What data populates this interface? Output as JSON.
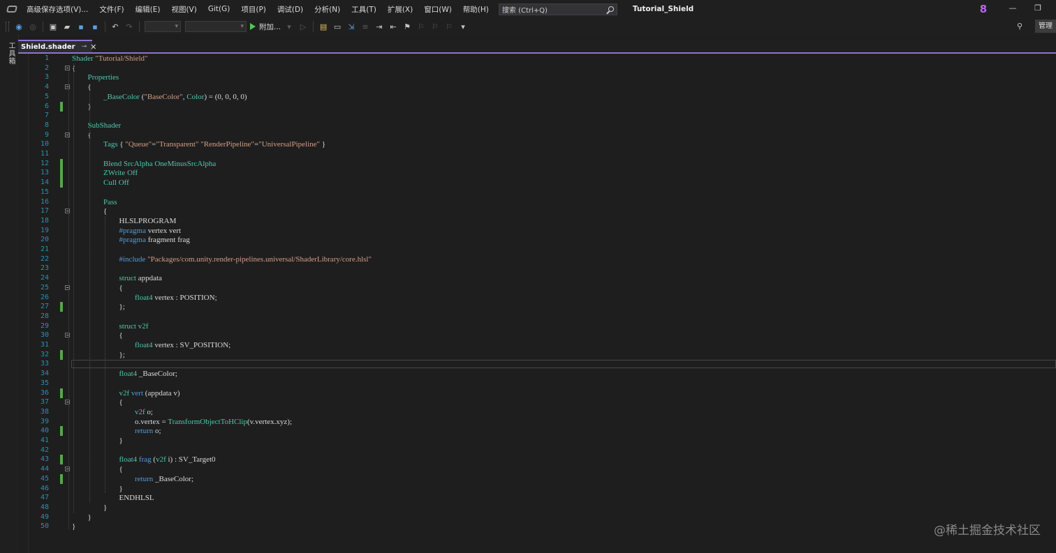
{
  "menubar": {
    "items": [
      "高级保存选项(V)...",
      "文件(F)",
      "编辑(E)",
      "视图(V)",
      "Git(G)",
      "项目(P)",
      "调试(D)",
      "分析(N)",
      "工具(T)",
      "扩展(X)",
      "窗口(W)",
      "帮助(H)"
    ],
    "search_placeholder": "搜索 (Ctrl+Q)",
    "title": "Tutorial_Shield",
    "notification_count": "8"
  },
  "toolbar": {
    "attach_label": "附加...",
    "manage_label": "管理"
  },
  "side": {
    "toolbox_label": "工具箱"
  },
  "tab": {
    "label": "Shield.shader"
  },
  "editor": {
    "current_line": 33,
    "lines": [
      {
        "n": "1",
        "t": "Shader \"Tutorial/Shield\"",
        "i": 0,
        "m": false,
        "f": false
      },
      {
        "n": "2",
        "t": "{",
        "i": 0,
        "m": false,
        "f": true
      },
      {
        "n": "3",
        "t": "Properties",
        "i": 1,
        "m": false,
        "f": false
      },
      {
        "n": "4",
        "t": "{",
        "i": 1,
        "m": false,
        "f": true
      },
      {
        "n": "5",
        "t": "_BaseColor (\"BaseColor\", Color) = (0, 0, 0, 0)",
        "i": 2,
        "m": false,
        "f": false
      },
      {
        "n": "6",
        "t": "}",
        "i": 1,
        "m": true,
        "f": false
      },
      {
        "n": "7",
        "t": "",
        "i": 0,
        "m": false,
        "f": false
      },
      {
        "n": "8",
        "t": "SubShader",
        "i": 1,
        "m": false,
        "f": false
      },
      {
        "n": "9",
        "t": "{",
        "i": 1,
        "m": false,
        "f": true
      },
      {
        "n": "10",
        "t": "Tags { \"Queue\"=\"Transparent\" \"RenderPipeline\"=\"UniversalPipeline\" }",
        "i": 2,
        "m": false,
        "f": false
      },
      {
        "n": "11",
        "t": "",
        "i": 0,
        "m": false,
        "f": false
      },
      {
        "n": "12",
        "t": "Blend SrcAlpha OneMinusSrcAlpha",
        "i": 2,
        "m": true,
        "f": false
      },
      {
        "n": "13",
        "t": "ZWrite Off",
        "i": 2,
        "m": true,
        "f": false
      },
      {
        "n": "14",
        "t": "Cull Off",
        "i": 2,
        "m": true,
        "f": false
      },
      {
        "n": "15",
        "t": "",
        "i": 0,
        "m": false,
        "f": false
      },
      {
        "n": "16",
        "t": "Pass",
        "i": 2,
        "m": false,
        "f": false
      },
      {
        "n": "17",
        "t": "{",
        "i": 2,
        "m": false,
        "f": true
      },
      {
        "n": "18",
        "t": "HLSLPROGRAM",
        "i": 3,
        "m": false,
        "f": false
      },
      {
        "n": "19",
        "t": "#pragma vertex vert",
        "i": 3,
        "m": false,
        "f": false
      },
      {
        "n": "20",
        "t": "#pragma fragment frag",
        "i": 3,
        "m": false,
        "f": false
      },
      {
        "n": "21",
        "t": "",
        "i": 0,
        "m": false,
        "f": false
      },
      {
        "n": "22",
        "t": "#include \"Packages/com.unity.render-pipelines.universal/ShaderLibrary/core.hlsl\"",
        "i": 3,
        "m": false,
        "f": false
      },
      {
        "n": "23",
        "t": "",
        "i": 0,
        "m": false,
        "f": false
      },
      {
        "n": "24",
        "t": "struct appdata",
        "i": 3,
        "m": false,
        "f": false
      },
      {
        "n": "25",
        "t": "{",
        "i": 3,
        "m": false,
        "f": true
      },
      {
        "n": "26",
        "t": "float4 vertex : POSITION;",
        "i": 4,
        "m": false,
        "f": false
      },
      {
        "n": "27",
        "t": "};",
        "i": 3,
        "m": true,
        "f": false
      },
      {
        "n": "28",
        "t": "",
        "i": 0,
        "m": false,
        "f": false
      },
      {
        "n": "29",
        "t": "struct v2f",
        "i": 3,
        "m": false,
        "f": false
      },
      {
        "n": "30",
        "t": "{",
        "i": 3,
        "m": false,
        "f": true
      },
      {
        "n": "31",
        "t": "float4 vertex : SV_POSITION;",
        "i": 4,
        "m": false,
        "f": false
      },
      {
        "n": "32",
        "t": "};",
        "i": 3,
        "m": true,
        "f": false
      },
      {
        "n": "33",
        "t": "",
        "i": 0,
        "m": false,
        "f": false
      },
      {
        "n": "34",
        "t": "float4 _BaseColor;",
        "i": 3,
        "m": false,
        "f": false
      },
      {
        "n": "35",
        "t": "",
        "i": 0,
        "m": false,
        "f": false
      },
      {
        "n": "36",
        "t": "v2f vert (appdata v)",
        "i": 3,
        "m": true,
        "f": false
      },
      {
        "n": "37",
        "t": "{",
        "i": 3,
        "m": false,
        "f": true
      },
      {
        "n": "38",
        "t": "v2f o;",
        "i": 4,
        "m": false,
        "f": false
      },
      {
        "n": "39",
        "t": "o.vertex = TransformObjectToHClip(v.vertex.xyz);",
        "i": 4,
        "m": false,
        "f": false
      },
      {
        "n": "40",
        "t": "return o;",
        "i": 4,
        "m": true,
        "f": false
      },
      {
        "n": "41",
        "t": "}",
        "i": 3,
        "m": false,
        "f": false
      },
      {
        "n": "42",
        "t": "",
        "i": 0,
        "m": false,
        "f": false
      },
      {
        "n": "43",
        "t": "float4 frag (v2f i) : SV_Target0",
        "i": 3,
        "m": true,
        "f": false
      },
      {
        "n": "44",
        "t": "{",
        "i": 3,
        "m": false,
        "f": true
      },
      {
        "n": "45",
        "t": "return _BaseColor;",
        "i": 4,
        "m": true,
        "f": false
      },
      {
        "n": "46",
        "t": "}",
        "i": 3,
        "m": false,
        "f": false
      },
      {
        "n": "47",
        "t": "ENDHLSL",
        "i": 3,
        "m": false,
        "f": false
      },
      {
        "n": "48",
        "t": "}",
        "i": 2,
        "m": false,
        "f": false
      },
      {
        "n": "49",
        "t": "}",
        "i": 1,
        "m": false,
        "f": false
      },
      {
        "n": "50",
        "t": "}",
        "i": 0,
        "m": false,
        "f": false
      }
    ]
  },
  "watermark": "@稀土掘金技术社区",
  "colors": {
    "accent": "#8f72d6",
    "line_number": "#2b91af",
    "change_mark": "#57a64a",
    "keyword": "#4ec9b0",
    "blue_keyword": "#569cd6",
    "string": "#d69d85"
  }
}
